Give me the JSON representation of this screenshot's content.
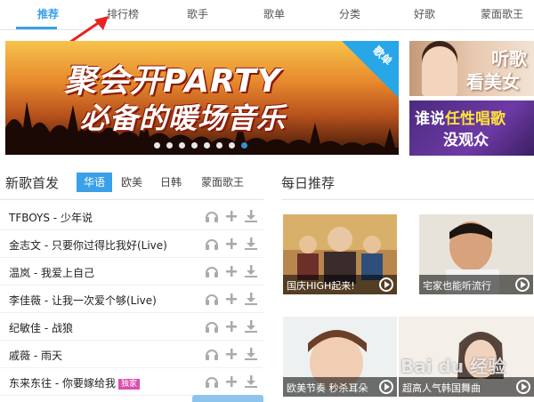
{
  "nav": {
    "tabs": [
      {
        "label": "推荐",
        "active": true
      },
      {
        "label": "排行榜"
      },
      {
        "label": "歌手"
      },
      {
        "label": "歌单"
      },
      {
        "label": "分类"
      },
      {
        "label": "好歌"
      },
      {
        "label": "蒙面歌王"
      }
    ]
  },
  "banner": {
    "line1": "聚会开PARTY",
    "line2": "必备的暖场音乐",
    "corner": "歌单",
    "slide_count": 8,
    "active_slide": 7
  },
  "side_ads": [
    {
      "line1": "听歌",
      "line2": "看美女"
    },
    {
      "line1_a": "谁说",
      "line1_b": "任性唱歌",
      "line2": "没观众"
    }
  ],
  "new_songs": {
    "title": "新歌首发",
    "tabs": [
      "华语",
      "欧美",
      "日韩",
      "蒙面歌王"
    ],
    "active_tab": 0,
    "songs": [
      {
        "title": "TFBOYS - 少年说"
      },
      {
        "title": "金志文 - 只要你过得比我好(Live)"
      },
      {
        "title": "温岚 - 我爱上自己"
      },
      {
        "title": "李佳薇 - 让我一次爱个够(Live)"
      },
      {
        "title": "纪敏佳 - 战狼"
      },
      {
        "title": "戚薇 - 雨天"
      },
      {
        "title": "东来东往 - 你要嫁给我",
        "tag": "独家"
      }
    ]
  },
  "daily": {
    "title": "每日推荐",
    "cards": [
      {
        "caption": "国庆HIGH起来!"
      },
      {
        "caption": "宅家也能听流行"
      },
      {
        "caption": "欧美节奏 秒杀耳朵"
      },
      {
        "caption": "超高人气韩国舞曲"
      }
    ]
  },
  "watermark": "Bai du 经验",
  "colors": {
    "accent": "#3aa0e8",
    "tag": "#d94fb0",
    "arrow": "#e8231f"
  }
}
